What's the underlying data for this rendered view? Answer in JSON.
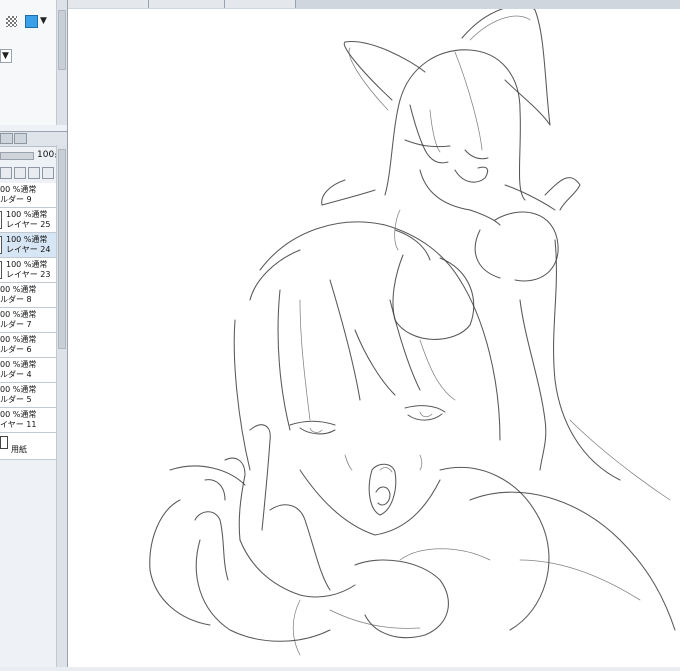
{
  "left_panel": {
    "opacity_value": "100",
    "layers": [
      {
        "line1": "00 %通常",
        "line2": "ルダー 9",
        "selected": false,
        "thumb": false
      },
      {
        "line1": "100 %通常",
        "line2": "レイヤー 25",
        "selected": false,
        "thumb": true
      },
      {
        "line1": "100 %通常",
        "line2": "レイヤー 24",
        "selected": true,
        "thumb": true
      },
      {
        "line1": "100 %通常",
        "line2": "レイヤー 23",
        "selected": false,
        "thumb": true
      },
      {
        "line1": "00 %通常",
        "line2": "ルダー 8",
        "selected": false,
        "thumb": false
      },
      {
        "line1": "00 %通常",
        "line2": "ルダー 7",
        "selected": false,
        "thumb": false
      },
      {
        "line1": "00 %通常",
        "line2": "ルダー 6",
        "selected": false,
        "thumb": false
      },
      {
        "line1": "00 %通常",
        "line2": "ルダー 4",
        "selected": false,
        "thumb": false
      },
      {
        "line1": "00 %通常",
        "line2": "ルダー 5",
        "selected": false,
        "thumb": false
      },
      {
        "line1": "00 %通常",
        "line2": "イヤー 11",
        "selected": false,
        "thumb": false
      }
    ],
    "paper_label": "用紙"
  },
  "icons": {
    "checker": "transparency-checker-icon",
    "color_swatch": "color-swatch-icon",
    "dropdown": "chevron-down-icon",
    "paper": "paper-layer-icon"
  },
  "colors": {
    "swatch": "#3aa0e8",
    "selected_layer": "#d6e6f5",
    "canvas": "#ffffff",
    "line": "#3d3a3a"
  }
}
